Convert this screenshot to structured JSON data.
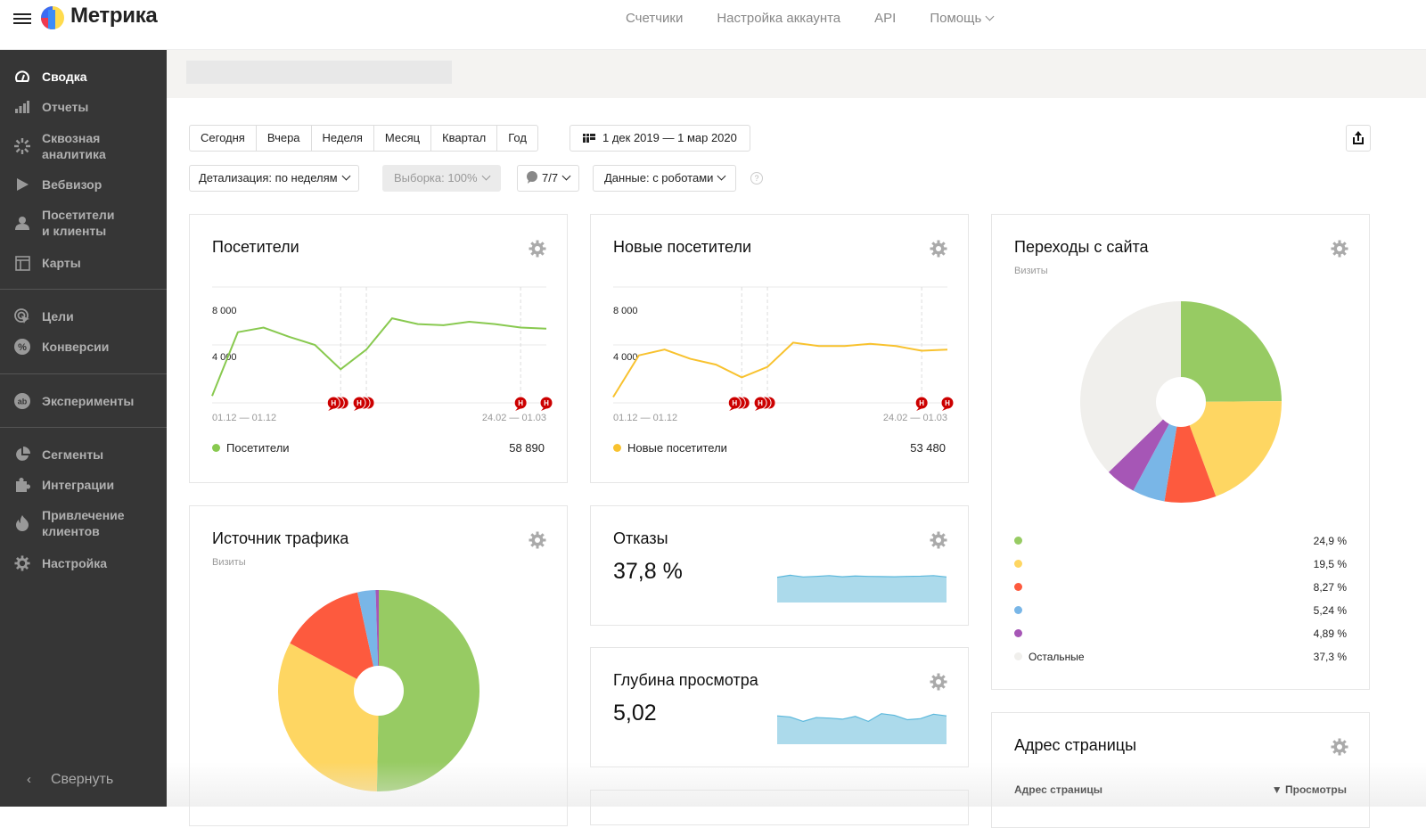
{
  "header": {
    "brand": "Метрика",
    "nav": [
      "Счетчики",
      "Настройка аккаунта",
      "API",
      "Помощь"
    ]
  },
  "sidebar": {
    "items": [
      {
        "label": "Сводка",
        "icon": "gauge-icon",
        "active": true
      },
      {
        "label": "Отчеты",
        "icon": "bar-chart-icon"
      },
      {
        "label": "Сквозная\nаналитика",
        "icon": "burst-icon"
      },
      {
        "label": "Вебвизор",
        "icon": "play-icon"
      },
      {
        "label": "Посетители\nи клиенты",
        "icon": "user-icon"
      },
      {
        "label": "Карты",
        "icon": "map-layout-icon"
      },
      {
        "label": "Цели",
        "icon": "target-icon"
      },
      {
        "label": "Конверсии",
        "icon": "percent-icon"
      },
      {
        "label": "Эксперименты",
        "icon": "ab-icon"
      },
      {
        "label": "Сегменты",
        "icon": "pie-icon"
      },
      {
        "label": "Интеграции",
        "icon": "puzzle-icon"
      },
      {
        "label": "Привлечение\nклиентов",
        "icon": "flame-icon"
      },
      {
        "label": "Настройка",
        "icon": "gear-icon"
      }
    ],
    "collapse_label": "Свернуть"
  },
  "toolbar": {
    "periods": [
      "Сегодня",
      "Вчера",
      "Неделя",
      "Месяц",
      "Квартал",
      "Год"
    ],
    "date_range": "1 дек 2019 — 1 мар 2020",
    "detail": "Детализация: по неделям",
    "sample": "Выборка: 100%",
    "attribution": "7/7",
    "data": "Данные: с роботами",
    "help": "?"
  },
  "widgets": {
    "visitors": {
      "title": "Посетители",
      "legend": "Посетители",
      "total": "58 890",
      "color": "#88c94f"
    },
    "new_visitors": {
      "title": "Новые посетители",
      "legend": "Новые посетители",
      "total": "53 480",
      "color": "#f8c22f"
    },
    "site_exits": {
      "title": "Переходы с сайта",
      "subtitle": "Визиты",
      "legend": [
        {
          "label": "",
          "value": "24,9 %",
          "color": "#97cb63"
        },
        {
          "label": "",
          "value": "19,5 %",
          "color": "#fed662"
        },
        {
          "label": "",
          "value": "8,27 %",
          "color": "#fd5a3e"
        },
        {
          "label": "",
          "value": "5,24 %",
          "color": "#79b6e7"
        },
        {
          "label": "",
          "value": "4,89 %",
          "color": "#a656b6"
        },
        {
          "label": "Остальные",
          "value": "37,3 %",
          "color": "#f0efec"
        }
      ]
    },
    "traffic_source": {
      "title": "Источник трафика",
      "subtitle": "Визиты"
    },
    "bounce": {
      "title": "Отказы",
      "value": "37,8 %"
    },
    "depth": {
      "title": "Глубина просмотра",
      "value": "5,02"
    },
    "page_address": {
      "title": "Адрес страницы",
      "col1": "Адрес страницы",
      "col2": "▼ Просмотры"
    }
  },
  "chart_data": [
    {
      "type": "line",
      "title": "Посетители",
      "series": [
        {
          "name": "Посетители",
          "values": [
            600,
            6100,
            6500,
            5700,
            5000,
            2900,
            4600,
            7300,
            6800,
            6700,
            7000,
            6800,
            6500,
            6400
          ]
        }
      ],
      "ylim": [
        0,
        10000
      ],
      "yticks": [
        "8 000",
        "4 000"
      ],
      "xticks": [
        "01.12 — 01.12",
        "24.02 — 01.03"
      ],
      "annotation_label": "Н",
      "grid": true
    },
    {
      "type": "line",
      "title": "Новые посетители",
      "series": [
        {
          "name": "Новые посетители",
          "values": [
            500,
            4100,
            4600,
            3800,
            3300,
            2200,
            3100,
            5200,
            4900,
            4900,
            5100,
            4900,
            4500,
            4600
          ]
        }
      ],
      "ylim": [
        0,
        10000
      ],
      "yticks": [
        "8 000",
        "4 000"
      ],
      "xticks": [
        "01.12 — 01.12",
        "24.02 — 01.03"
      ],
      "annotation_label": "Н",
      "grid": true
    },
    {
      "type": "pie",
      "title": "Переходы с сайта",
      "values": [
        24.9,
        19.5,
        8.27,
        5.24,
        4.89,
        37.3
      ],
      "colors": [
        "#97cb63",
        "#fed662",
        "#fd5a3e",
        "#79b6e7",
        "#a656b6",
        "#f0efec"
      ]
    },
    {
      "type": "pie",
      "title": "Источник трафика",
      "values": [
        50.3,
        32.5,
        13.8,
        2.9,
        0.5
      ],
      "colors": [
        "#97cb63",
        "#fed662",
        "#fd5a3e",
        "#79b6e7",
        "#a656b6"
      ]
    },
    {
      "type": "area",
      "title": "Отказы",
      "values": [
        37.5,
        38.6,
        37.7,
        38.0,
        38.4,
        37.8,
        38.2,
        38.0,
        37.9,
        37.8,
        38.0,
        38.1,
        38.4,
        37.7
      ]
    },
    {
      "type": "area",
      "title": "Глубина просмотра",
      "values": [
        5.1,
        5.0,
        4.6,
        4.95,
        4.9,
        4.8,
        5.05,
        4.6,
        5.3,
        5.15,
        4.75,
        4.85,
        5.25,
        5.1
      ]
    }
  ]
}
